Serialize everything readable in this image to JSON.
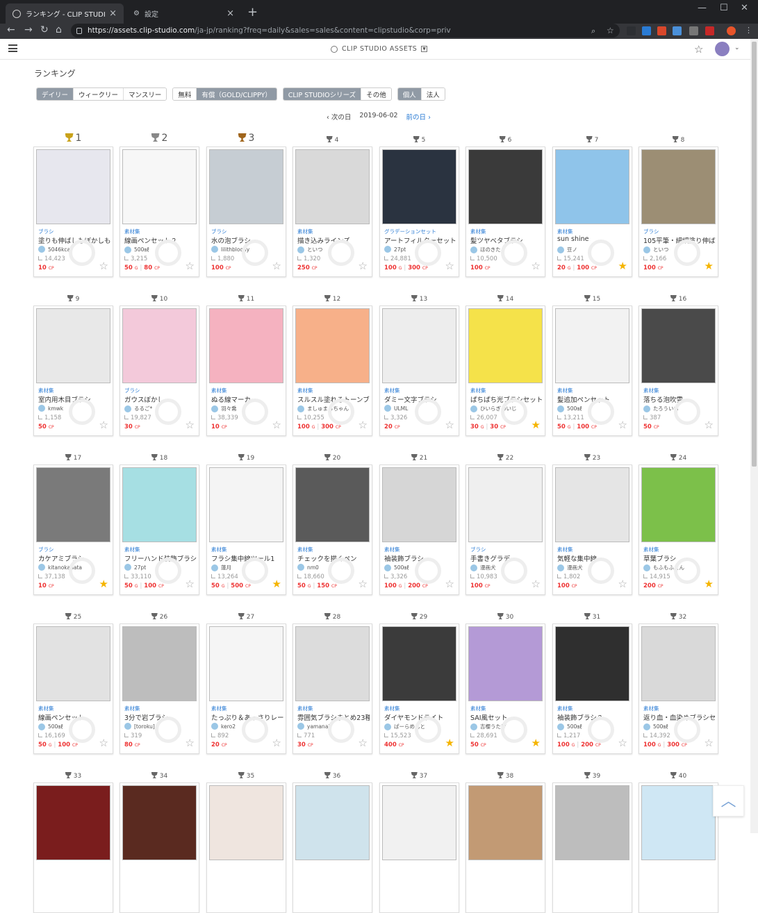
{
  "browser": {
    "tabs": [
      {
        "title": "ランキング - CLIP STUDIO ASSETS",
        "active": true
      },
      {
        "title": "設定",
        "active": false
      }
    ],
    "url_host": "https://assets.clip-studio.com",
    "url_path": "/ja-jp/ranking?freq=daily&sales=sales&content=clipstudio&corp=priv"
  },
  "header": {
    "brand": "CLIP STUDIO ASSETS"
  },
  "page": {
    "title": "ランキング"
  },
  "filters": [
    [
      {
        "label": "デイリー",
        "on": true
      },
      {
        "label": "ウィークリー",
        "on": false
      },
      {
        "label": "マンスリー",
        "on": false
      }
    ],
    [
      {
        "label": "無料",
        "on": false
      },
      {
        "label": "有償（GOLD/CLIPPY）",
        "on": true
      }
    ],
    [
      {
        "label": "CLIP STUDIOシリーズ",
        "on": true
      },
      {
        "label": "その他",
        "on": false
      }
    ],
    [
      {
        "label": "個人",
        "on": true
      },
      {
        "label": "法人",
        "on": false
      }
    ]
  ],
  "datenav": {
    "prev": "‹ 次の日",
    "date": "2019-06-02",
    "next": "前の日 ›"
  },
  "items": [
    {
      "rank": "1",
      "cat": "ブラシ",
      "title": "塗りも伸ばしもぼかしも",
      "author": "5046kcal",
      "dl": "14,423",
      "price": [
        [
          "10",
          "CP"
        ]
      ],
      "fav": false,
      "thumb": "#e7e7ee"
    },
    {
      "rank": "2",
      "cat": "素材集",
      "title": "線画ペンセット２",
      "author": "500㎖",
      "dl": "3,215",
      "price": [
        [
          "50",
          "G"
        ],
        [
          "80",
          "CP"
        ]
      ],
      "fav": false,
      "thumb": "#f7f7f7"
    },
    {
      "rank": "3",
      "cat": "ブラシ",
      "title": "水の泡ブラシ",
      "author": "lilithbloody",
      "dl": "1,880",
      "price": [
        [
          "100",
          "CP"
        ]
      ],
      "fav": false,
      "thumb": "#c6cdd3"
    },
    {
      "rank": "4",
      "cat": "素材集",
      "title": "描き込みラインズ",
      "author": "といつ",
      "dl": "1,320",
      "price": [
        [
          "250",
          "CP"
        ]
      ],
      "fav": false,
      "thumb": "#d9d9d9"
    },
    {
      "rank": "5",
      "cat": "グラデーションセット",
      "title": "アートフィルターセット",
      "author": "27pt",
      "dl": "24,881",
      "price": [
        [
          "100",
          "G"
        ],
        [
          "300",
          "CP"
        ]
      ],
      "fav": false,
      "thumb": "#2a3340"
    },
    {
      "rank": "6",
      "cat": "素材集",
      "title": "髪ツヤベタブラシ",
      "author": "ほのきた",
      "dl": "10,500",
      "price": [
        [
          "100",
          "CP"
        ]
      ],
      "fav": false,
      "thumb": "#3a3a3a"
    },
    {
      "rank": "7",
      "cat": "素材集",
      "title": "sun shine",
      "author": "豆ノ",
      "dl": "15,241",
      "price": [
        [
          "20",
          "G"
        ],
        [
          "100",
          "CP"
        ]
      ],
      "fav": true,
      "thumb": "#8fc4ea"
    },
    {
      "rank": "8",
      "cat": "ブラシ",
      "title": "105平筆・細細塗り伸ば",
      "author": "といつ",
      "dl": "2,166",
      "price": [
        [
          "100",
          "CP"
        ]
      ],
      "fav": true,
      "thumb": "#9c8e74"
    },
    {
      "rank": "9",
      "cat": "素材集",
      "title": "室内用木目ブラシ",
      "author": "kmwk",
      "dl": "1,158",
      "price": [
        [
          "50",
          "CP"
        ]
      ],
      "fav": false,
      "thumb": "#e8e8e8"
    },
    {
      "rank": "10",
      "cat": "ブラシ",
      "title": "ガウスぼかし",
      "author": "るるご*",
      "dl": "19,827",
      "price": [
        [
          "30",
          "CP"
        ]
      ],
      "fav": false,
      "thumb": "#f3c9da"
    },
    {
      "rank": "11",
      "cat": "素材集",
      "title": "ぬる線マーカー",
      "author": "羽々喬",
      "dl": "38,339",
      "price": [
        [
          "10",
          "CP"
        ]
      ],
      "fav": false,
      "thumb": "#f5b2c0"
    },
    {
      "rank": "12",
      "cat": "素材集",
      "title": "スルスル塗れるトーンブ",
      "author": "ましゅまろちゃん",
      "dl": "10,255",
      "price": [
        [
          "100",
          "G"
        ],
        [
          "300",
          "CP"
        ]
      ],
      "fav": false,
      "thumb": "#f7b089"
    },
    {
      "rank": "13",
      "cat": "素材集",
      "title": "ダミー文字ブラシ",
      "author": "ULML",
      "dl": "3,326",
      "price": [
        [
          "20",
          "CP"
        ]
      ],
      "fav": false,
      "thumb": "#ededed"
    },
    {
      "rank": "14",
      "cat": "素材集",
      "title": "ぱちぱち光ブラシセット",
      "author": "ひいらぎめいじ",
      "dl": "26,007",
      "price": [
        [
          "30",
          "G"
        ],
        [
          "30",
          "CP"
        ]
      ],
      "fav": true,
      "thumb": "#f5e24a"
    },
    {
      "rank": "15",
      "cat": "素材集",
      "title": "髪追加ペンセット",
      "author": "500㎖",
      "dl": "13,211",
      "price": [
        [
          "50",
          "G"
        ],
        [
          "100",
          "CP"
        ]
      ],
      "fav": false,
      "thumb": "#f2f2f2"
    },
    {
      "rank": "16",
      "cat": "素材集",
      "title": "落ちる泡吹雪",
      "author": "たろういも",
      "dl": "387",
      "price": [
        [
          "50",
          "CP"
        ]
      ],
      "fav": false,
      "thumb": "#4a4a4a"
    },
    {
      "rank": "17",
      "cat": "ブラシ",
      "title": "カケアミブラシ",
      "author": "kitanokanata",
      "dl": "37,138",
      "price": [
        [
          "10",
          "CP"
        ]
      ],
      "fav": true,
      "thumb": "#7a7a7a"
    },
    {
      "rank": "18",
      "cat": "素材集",
      "title": "フリーハンド装飾ブラシ",
      "author": "27pt",
      "dl": "33,110",
      "price": [
        [
          "50",
          "G"
        ],
        [
          "100",
          "CP"
        ]
      ],
      "fav": false,
      "thumb": "#a6dfe3"
    },
    {
      "rank": "19",
      "cat": "素材集",
      "title": "フラシ集中線ツール1",
      "author": "蓮月",
      "dl": "13,264",
      "price": [
        [
          "50",
          "G"
        ],
        [
          "500",
          "CP"
        ]
      ],
      "fav": true,
      "thumb": "#f4f4f4"
    },
    {
      "rank": "20",
      "cat": "素材集",
      "title": "チェックを描くペン",
      "author": "nm0",
      "dl": "18,660",
      "price": [
        [
          "50",
          "G"
        ],
        [
          "150",
          "CP"
        ]
      ],
      "fav": false,
      "thumb": "#5a5a5a"
    },
    {
      "rank": "21",
      "cat": "素材集",
      "title": "袖装飾ブラシ",
      "author": "500㎖",
      "dl": "3,326",
      "price": [
        [
          "100",
          "G"
        ],
        [
          "200",
          "CP"
        ]
      ],
      "fav": false,
      "thumb": "#d6d6d6"
    },
    {
      "rank": "22",
      "cat": "ブラシ",
      "title": "手書きグラデ",
      "author": "漫画犬",
      "dl": "10,983",
      "price": [
        [
          "100",
          "CP"
        ]
      ],
      "fav": false,
      "thumb": "#efefef"
    },
    {
      "rank": "23",
      "cat": "素材集",
      "title": "気軽な集中線",
      "author": "漫画犬",
      "dl": "1,802",
      "price": [
        [
          "100",
          "CP"
        ]
      ],
      "fav": false,
      "thumb": "#e5e5e5"
    },
    {
      "rank": "24",
      "cat": "素材集",
      "title": "草葉ブラシ",
      "author": "もふもふとん",
      "dl": "14,915",
      "price": [
        [
          "200",
          "CP"
        ]
      ],
      "fav": true,
      "thumb": "#7cc04a"
    },
    {
      "rank": "25",
      "cat": "素材集",
      "title": "線画ペンセット",
      "author": "500㎖",
      "dl": "16,169",
      "price": [
        [
          "50",
          "G"
        ],
        [
          "100",
          "CP"
        ]
      ],
      "fav": false,
      "thumb": "#e2e2e2"
    },
    {
      "rank": "26",
      "cat": "素材集",
      "title": "3分で岩ブラシ",
      "author": "[toroku]",
      "dl": "319",
      "price": [
        [
          "80",
          "CP"
        ]
      ],
      "fav": false,
      "thumb": "#bdbdbd"
    },
    {
      "rank": "27",
      "cat": "素材集",
      "title": "たっぷり＆あっさりレー",
      "author": "kero2",
      "dl": "892",
      "price": [
        [
          "20",
          "CP"
        ]
      ],
      "fav": false,
      "thumb": "#f5f5f5"
    },
    {
      "rank": "28",
      "cat": "素材集",
      "title": "雰囲気ブラシまとめ23種",
      "author": "yamanai",
      "dl": "771",
      "price": [
        [
          "30",
          "CP"
        ]
      ],
      "fav": false,
      "thumb": "#dcdcdc"
    },
    {
      "rank": "29",
      "cat": "素材集",
      "title": "ダイヤモンドライト",
      "author": "ぱーらめんと",
      "dl": "15,523",
      "price": [
        [
          "400",
          "CP"
        ]
      ],
      "fav": true,
      "thumb": "#3b3b3b"
    },
    {
      "rank": "30",
      "cat": "素材集",
      "title": "SAI風セット",
      "author": "吉櫻うたげ",
      "dl": "28,691",
      "price": [
        [
          "50",
          "CP"
        ]
      ],
      "fav": true,
      "thumb": "#b49ad6"
    },
    {
      "rank": "31",
      "cat": "素材集",
      "title": "袖装飾ブラシ２",
      "author": "500㎖",
      "dl": "1,217",
      "price": [
        [
          "100",
          "G"
        ],
        [
          "200",
          "CP"
        ]
      ],
      "fav": false,
      "thumb": "#2f2f2f"
    },
    {
      "rank": "32",
      "cat": "素材集",
      "title": "返り血・血染めブラシセ",
      "author": "500㎖",
      "dl": "14,392",
      "price": [
        [
          "100",
          "G"
        ],
        [
          "300",
          "CP"
        ]
      ],
      "fav": false,
      "thumb": "#d9d9d9"
    },
    {
      "rank": "33",
      "thumb": "#7a1d1d"
    },
    {
      "rank": "34",
      "thumb": "#5a2a20"
    },
    {
      "rank": "35",
      "thumb": "#efe5df"
    },
    {
      "rank": "36",
      "thumb": "#cfe3ec"
    },
    {
      "rank": "37",
      "thumb": "#f1f1f1"
    },
    {
      "rank": "38",
      "thumb": "#c29a74"
    },
    {
      "rank": "39",
      "thumb": "#bdbdbd"
    },
    {
      "rank": "40",
      "thumb": "#cfe7f4"
    }
  ],
  "colors": {
    "accent": "#2a7bd4",
    "price": "#ee3333",
    "fav": "#f5b400"
  }
}
